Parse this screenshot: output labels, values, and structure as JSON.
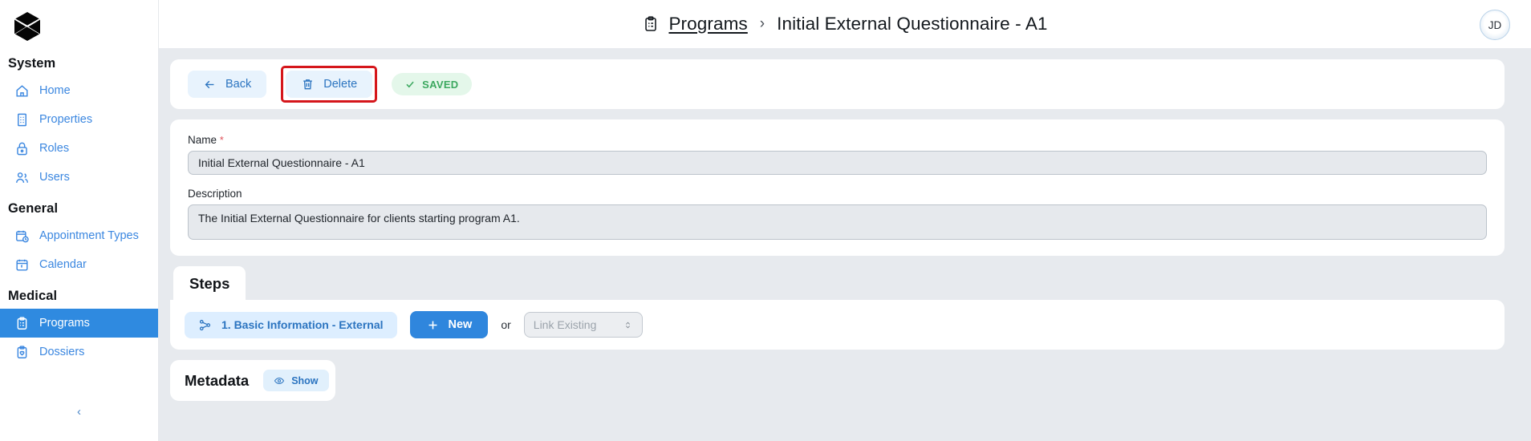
{
  "brand": {
    "logo_icon": "hexagon-x-logo"
  },
  "sidebar": {
    "groups": [
      {
        "title": "System",
        "items": [
          {
            "label": "Home",
            "icon": "home-icon",
            "active": false
          },
          {
            "label": "Properties",
            "icon": "building-icon",
            "active": false
          },
          {
            "label": "Roles",
            "icon": "lock-icon",
            "active": false
          },
          {
            "label": "Users",
            "icon": "users-icon",
            "active": false
          }
        ]
      },
      {
        "title": "General",
        "items": [
          {
            "label": "Appointment Types",
            "icon": "calendar-clock-icon",
            "active": false
          },
          {
            "label": "Calendar",
            "icon": "calendar-icon",
            "active": false
          }
        ]
      },
      {
        "title": "Medical",
        "items": [
          {
            "label": "Programs",
            "icon": "clipboard-list-icon",
            "active": true
          },
          {
            "label": "Dossiers",
            "icon": "clipboard-heart-icon",
            "active": false
          }
        ]
      }
    ],
    "collapse_glyph": "‹"
  },
  "header": {
    "breadcrumb_icon": "clipboard-icon",
    "breadcrumb_link": "Programs",
    "breadcrumb_separator": "›",
    "breadcrumb_current": "Initial External Questionnaire - A1",
    "avatar_initials": "JD"
  },
  "toolbar": {
    "back_label": "Back",
    "back_icon": "arrow-left-icon",
    "delete_label": "Delete",
    "delete_icon": "trash-icon",
    "saved_label": "SAVED",
    "saved_icon": "check-icon",
    "highlight_color": "#d5161b"
  },
  "form": {
    "name_label": "Name",
    "name_required_marker": "*",
    "name_value": "Initial External Questionnaire - A1",
    "name_placeholder": "Name",
    "description_label": "Description",
    "description_value": "The Initial External Questionnaire for clients starting program A1.",
    "description_placeholder": "Description"
  },
  "steps": {
    "tab_label": "Steps",
    "step_items": [
      {
        "label": "1. Basic Information - External",
        "icon": "nodes-icon"
      }
    ],
    "new_label": "New",
    "new_icon": "plus-icon",
    "or_label": "or",
    "link_existing_placeholder": "Link Existing",
    "link_existing_value": "",
    "link_existing_icon": "chevron-updown-icon"
  },
  "metadata": {
    "title": "Metadata",
    "show_label": "Show",
    "show_icon": "eye-icon"
  },
  "colors": {
    "accent_blue": "#2f86dd",
    "link_blue": "#3b87e0",
    "saved_green": "#3ca85f",
    "canvas_gray": "#e7eaee"
  }
}
